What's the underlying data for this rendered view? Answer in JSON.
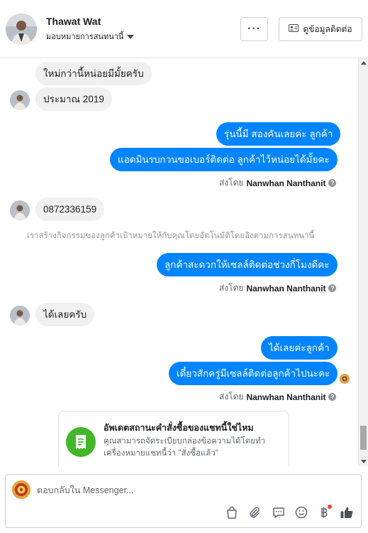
{
  "header": {
    "name": "Thawat Wat",
    "assign_label": "มอบหมายการสนทนานี้",
    "more_label": "···",
    "contact_label": "ดูข้อมูลติดต่อ"
  },
  "messages": {
    "m1": "ใหม่กว่านี้หน่อยมีมั้ยครับ",
    "m2": "ประมาณ 2019",
    "m3": "รุ่นนี้มี สองคันเลยค่ะ ลูกค้า",
    "m4": "แอดมินรบกวนขอเบอร์ติดต่อ ลูกค้าไว้หน่อยได้มั้ยคะ",
    "m5": "0872336159",
    "m6": "ลูกค้าสะดวกให้เซลล์ติดต่อช่วงกี่โมงดีคะ",
    "m7": "ได้เลยครับ",
    "m8": "ได้เลยค่ะลูกค้า",
    "m9": "เดี๋ยวสักครู่มีเซลล์ติดต่อลูกค้าไปนะคะ",
    "system_note": "เราสร้างกิจกรรมของลูกค้าเป้าหมายให้กับคุณโดยอัตโนมัติโดยอิงตามการสนทนานี้",
    "sent_by_prefix": "ส่งโดย",
    "sent_by_name": "Nanwhan Nanthanit"
  },
  "card": {
    "title": "อัพเดตสถานะคำสั่งซื้อของแชทนี้ใช่ไหม",
    "body": "คุณสามารถจัดระเบียบกล่องข้อความได้โดยทำเครื่องหมายแชทนี้ว่า \"สั่งซื้อแล้ว\""
  },
  "composer": {
    "placeholder": "ตอบกลับใน Messenger..."
  },
  "icons": [
    "shopping-bag-icon",
    "paperclip-icon",
    "saved-reply-icon",
    "emoji-icon",
    "baht-payment-icon",
    "like-icon"
  ],
  "colors": {
    "outgoing": "#0084ff",
    "incoming": "#f0f0f0",
    "card_icon": "#42b72a"
  }
}
